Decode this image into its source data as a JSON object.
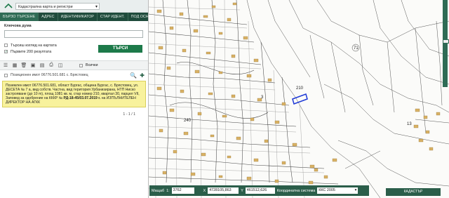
{
  "header": {
    "app_select": "Кадастрална карта и регистри"
  },
  "tabs": [
    {
      "label": "БЪРЗО ТЪРСЕНЕ"
    },
    {
      "label": "АДРЕС"
    },
    {
      "label": "ИДЕНТИФИКАТОР"
    },
    {
      "label": "СТАР ИДЕНТ."
    },
    {
      "label": "ПОД ОСНОВА"
    }
  ],
  "search": {
    "keyword_label": "Ключова дума",
    "keyword_value": "",
    "option_map": "Търсиш изглед на картата",
    "option_first": "Първите 200 резултата",
    "option_first_checked": "✓",
    "submit": "ТЪРСИ"
  },
  "toolbar": {
    "all_label": "Всички"
  },
  "result": {
    "header": "Позиционен имот 06776.501.681 с. Брястовец",
    "card_text": "Поземлен имот 06776.501.681, област Бургас, община Бургас, с. Брястовец, ул. ДЕСЕТА № 7 а, вид собств. Частна, вид територия Урбанизирана, НТП Ниско застрояване (до 10 m), площ 1081 кв. м, стар номер 210, квартал 30, парцел VII, Заповед за одобрение на КККР № ",
    "card_order": "РД-18-45/03.07.2019 г.",
    "card_tail": " на ИЗПЪЛНИТЕЛЕН ДИРЕКТОР НА АГКК",
    "pager": "1 - 1 / 1"
  },
  "map": {
    "labels": [
      "71",
      "3",
      "13",
      "240",
      "210"
    ]
  },
  "coordbar": {
    "scale_label": "Мащаб",
    "scale_prefix": "1:",
    "scale_value": "3762",
    "x_label": "X",
    "x_value": "4728105,863",
    "y_label": "Y",
    "y_value": "461512,626",
    "system_label": "Координатна система",
    "system_value": "ККС 2005"
  },
  "brand": "КАДАСТЪР"
}
